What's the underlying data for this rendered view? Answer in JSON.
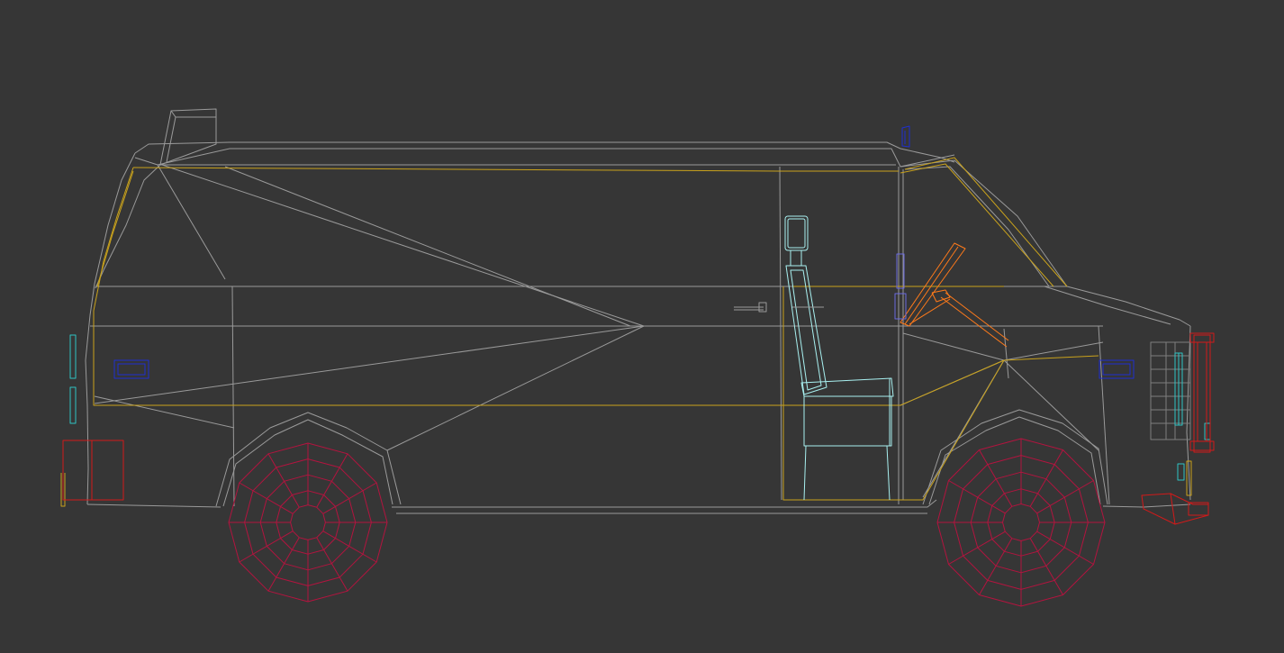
{
  "viewport": {
    "label": "",
    "background": "#363636"
  },
  "colors": {
    "body_wire": "#9a9a9a",
    "trim_wire": "#c9a21c",
    "wheel_wire": "#b3143f",
    "seat_wire": "#a8f0f0",
    "steering_wire": "#ff7a1a",
    "mirror_wire": "#1f2fd0",
    "grille_wire": "#7e7e7e",
    "bumper_wire": "#d11a1a",
    "light_wire": "#2fc4c4"
  },
  "objects": [
    "van-body",
    "body-trim",
    "front-wheel",
    "rear-wheel",
    "driver-seat",
    "steering-column",
    "side-mirror",
    "front-grille",
    "front-bumper",
    "rear-bumper",
    "roof-vent",
    "door-handle"
  ]
}
